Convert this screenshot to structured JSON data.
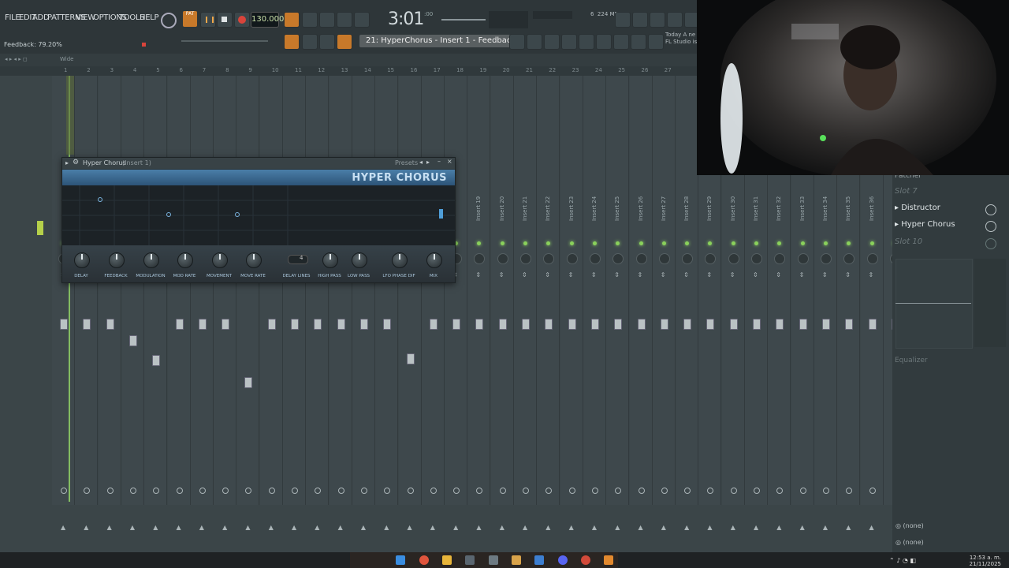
{
  "menu": [
    "FILE",
    "EDIT",
    "ADD",
    "PATTERNS",
    "VIEW",
    "OPTIONS",
    "TOOLS",
    "HELP"
  ],
  "toolbar": {
    "pat_label": "PAT",
    "tempo": "130.000",
    "time": "3:01",
    "time_sub": ":00",
    "hint_bar": "Feedback: 79.20%",
    "hint_panel": "21: HyperChorus - Insert 1 - Feedback",
    "memory_cpu": "6",
    "memory_mb": "224 MB",
    "memory_zero": "0",
    "news_line1": "Today  A ne",
    "news_line2": "FL Studio is",
    "view_mode": "Wide"
  },
  "ruler": [
    "1",
    "2",
    "3",
    "4",
    "5",
    "6",
    "7",
    "8",
    "9",
    "10",
    "11",
    "12",
    "13",
    "14",
    "15",
    "16",
    "17",
    "18",
    "19",
    "20",
    "21",
    "22",
    "23",
    "24",
    "25",
    "26",
    "27"
  ],
  "plugin": {
    "title": "Hyper Chorus",
    "title_sub": "(Insert 1)",
    "presets": "Presets",
    "brand": "HYPER CHORUS",
    "knobs": [
      "DELAY",
      "FEEDBACK",
      "MODULATION",
      "MOD RATE",
      "MOVEMENT",
      "MOVE RATE",
      "DELAY LINES",
      "HIGH PASS",
      "LOW PASS",
      "LFO PHASE DIF",
      "MIX"
    ],
    "delay_lines_value": "4"
  },
  "inserts": [
    "Insert 19",
    "Insert 20",
    "Insert 21",
    "Insert 22",
    "Insert 23",
    "Insert 24",
    "Insert 25",
    "Insert 26",
    "Insert 27",
    "Insert 28",
    "Insert 29",
    "Insert 30",
    "Insert 31",
    "Insert 32",
    "Insert 33",
    "Insert 34",
    "Insert 35",
    "Insert 36"
  ],
  "effects": {
    "slot_top": "Patcher",
    "slots": [
      {
        "label": "Slot 7",
        "empty": true
      },
      {
        "label": "Distructor",
        "empty": false
      },
      {
        "label": "Hyper Chorus",
        "empty": false
      },
      {
        "label": "Slot 10",
        "empty": true
      }
    ],
    "eq_label": "Equalizer",
    "route_in": "(none)",
    "route_out": "(none)"
  },
  "clock": {
    "time": "12:53 a. m.",
    "date": "21/11/2025"
  }
}
